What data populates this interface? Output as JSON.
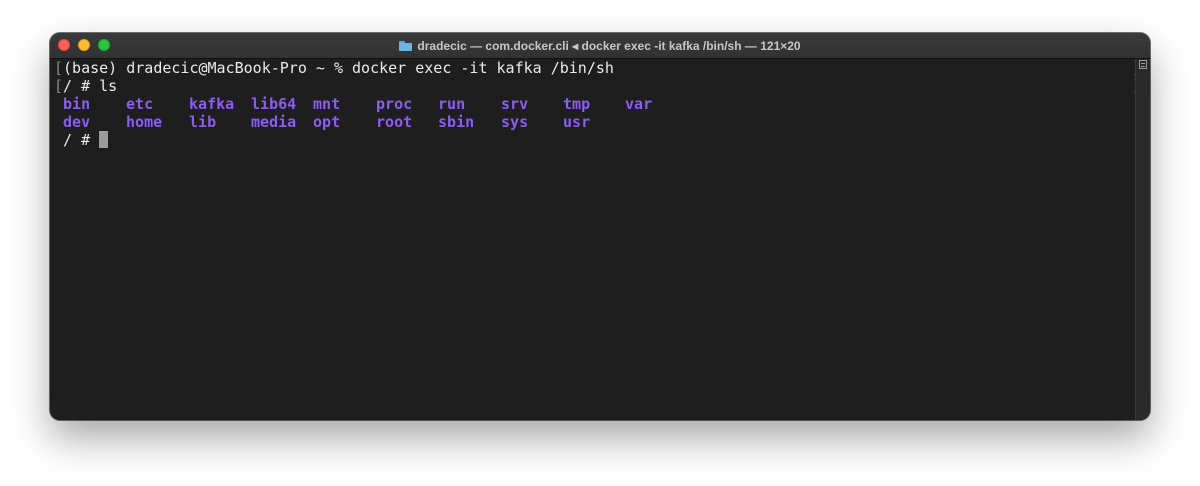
{
  "window": {
    "title": "dradecic — com.docker.cli ◂ docker exec -it kafka /bin/sh — 121×20",
    "folder_icon": "folder-icon"
  },
  "terminal": {
    "lines": [
      {
        "prompt": "(base) dradecic@MacBook-Pro ~ % ",
        "command": "docker exec -it kafka /bin/sh"
      },
      {
        "prompt": "/ # ",
        "command": "ls"
      }
    ],
    "ls_output": [
      [
        "bin",
        "etc",
        "kafka",
        "lib64",
        "mnt",
        "proc",
        "run",
        "srv",
        "tmp",
        "var"
      ],
      [
        "dev",
        "home",
        "lib",
        "media",
        "opt",
        "root",
        "sbin",
        "sys",
        "usr"
      ]
    ],
    "current_prompt": "/ # ",
    "dir_color": "#8b5cf6",
    "bracket_open": "[",
    "bracket_close": "]"
  }
}
